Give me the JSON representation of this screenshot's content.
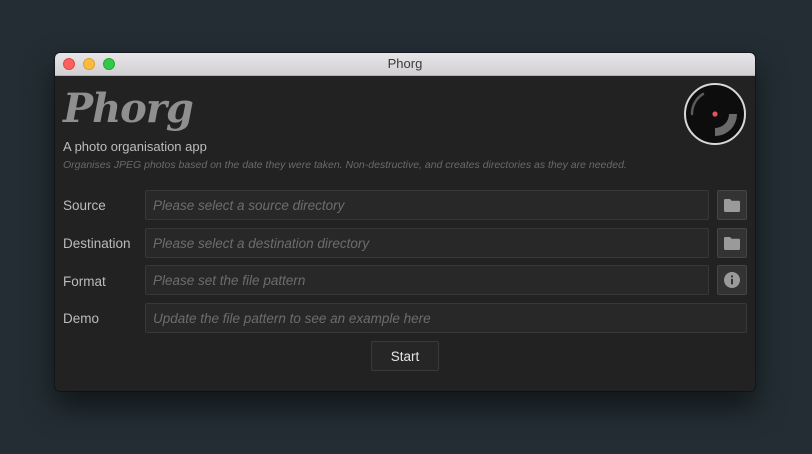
{
  "window": {
    "title": "Phorg"
  },
  "app": {
    "logo": "Phorg",
    "tagline": "A photo organisation app",
    "description": "Organises JPEG photos based on the date they were taken. Non-destructive, and creates directories as they are needed."
  },
  "form": {
    "source": {
      "label": "Source",
      "value": "",
      "placeholder": "Please select a source directory",
      "button_icon": "folder-icon"
    },
    "destination": {
      "label": "Destination",
      "value": "",
      "placeholder": "Please select a destination directory",
      "button_icon": "folder-icon"
    },
    "format": {
      "label": "Format",
      "value": "",
      "placeholder": "Please set the file pattern",
      "button_icon": "info-icon"
    },
    "demo": {
      "label": "Demo",
      "value": "",
      "placeholder": "Update the file pattern to see an example here"
    }
  },
  "start_label": "Start",
  "colors": {
    "background": "#232d33",
    "window": "#222222",
    "field": "#282828",
    "logo": "#8f8f8f",
    "spinner_dot": "#e8505b"
  }
}
